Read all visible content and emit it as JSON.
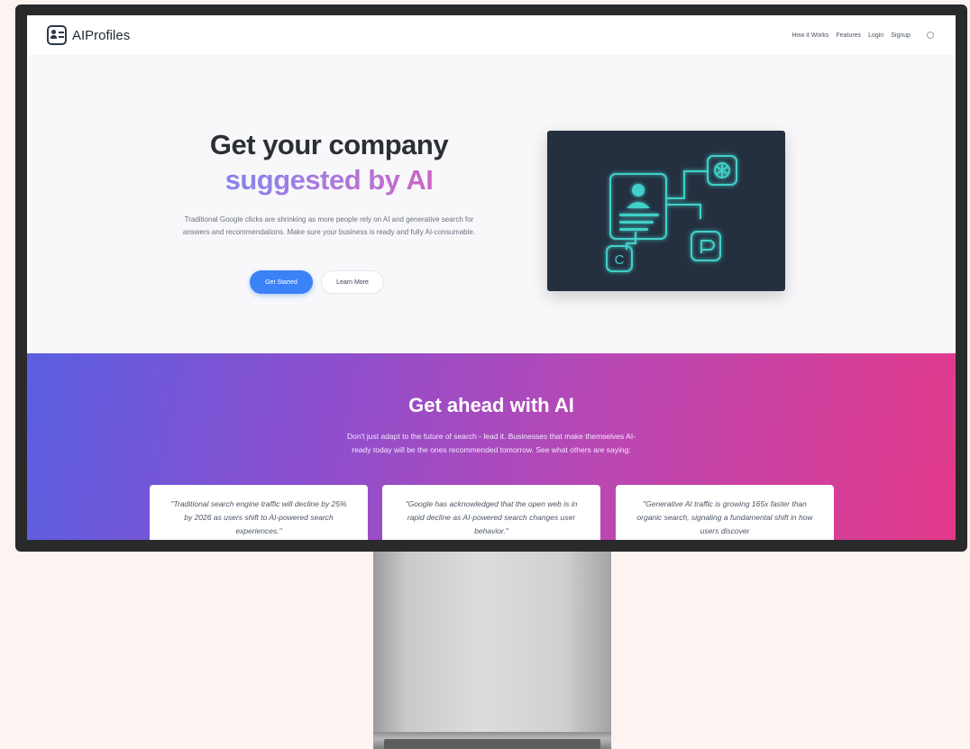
{
  "nav": {
    "brand": "AIProfiles",
    "links": [
      "How it Works",
      "Features",
      "Login",
      "Signup"
    ]
  },
  "hero": {
    "title_line1": "Get your company",
    "title_line2": "suggested by AI",
    "description": "Traditional Google clicks are shrinking as more people rely on AI and generative search for answers and recommendations. Make sure your business is ready and fully AI-consumable.",
    "primary_button": "Get Started",
    "secondary_button": "Learn More",
    "illustration_badge_c": "C"
  },
  "section": {
    "title": "Get ahead with AI",
    "description": "Don't just adapt to the future of search - lead it. Businesses that make themselves AI-ready today will be the ones recommended tomorrow. See what others are saying:",
    "quotes": [
      "\"Traditional search engine traffic will decline by 25% by 2026 as users shift to AI-powered search experiences.\"",
      "\"Google has acknowledged that the open web is in rapid decline as AI-powered search changes user behavior.\"",
      "\"Generative AI traffic is growing 165x faster than organic search, signaling a fundamental shift in how users discover"
    ]
  },
  "colors": {
    "primary": "#3b82f6",
    "illustration_bg": "#243040",
    "glow": "#3fd0c9",
    "gradient_start": "#5a5fe0",
    "gradient_end": "#e33a8a"
  }
}
